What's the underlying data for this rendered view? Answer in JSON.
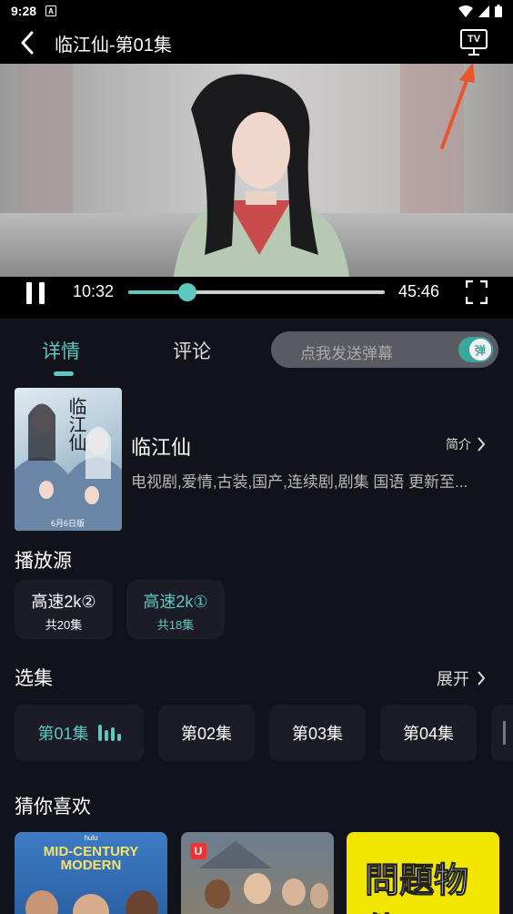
{
  "status_bar": {
    "time": "9:28",
    "notification_glyph": "A"
  },
  "header": {
    "title": "临江仙-第01集",
    "tv_label": "TV"
  },
  "player": {
    "current_time": "10:32",
    "total_time": "45:46",
    "progress": 0.23
  },
  "tabs": {
    "detail": "详情",
    "comment": "评论"
  },
  "danmaku": {
    "placeholder": "点我发送弹幕",
    "toggle_label": "弹",
    "enabled": true
  },
  "show": {
    "poster_title": "临江仙",
    "poster_date": "6月6日版",
    "title": "临江仙",
    "intro_label": "简介",
    "meta": "电视剧,爱情,古装,国产,连续剧,剧集 国语 更新至..."
  },
  "sources": {
    "title": "播放源",
    "items": [
      {
        "name": "高速2k②",
        "count": "共20集",
        "selected": false
      },
      {
        "name": "高速2k①",
        "count": "共18集",
        "selected": true
      }
    ]
  },
  "episodes": {
    "title": "选集",
    "expand_label": "展开",
    "items": [
      {
        "label": "第01集",
        "playing": true
      },
      {
        "label": "第02集",
        "playing": false
      },
      {
        "label": "第03集",
        "playing": false
      },
      {
        "label": "第04集",
        "playing": false
      }
    ]
  },
  "recommendations": {
    "title": "猜你喜欢",
    "items": [
      {
        "title_line1": "MID-CENTURY",
        "title_line2": "MODERN",
        "brand": "hulu"
      },
      {
        "badge": "U"
      },
      {
        "title": "問題物件"
      }
    ]
  },
  "colors": {
    "accent": "#5ec7c0",
    "background": "#12121a",
    "card": "#1c1c26",
    "annotation_arrow": "#e8552f"
  }
}
